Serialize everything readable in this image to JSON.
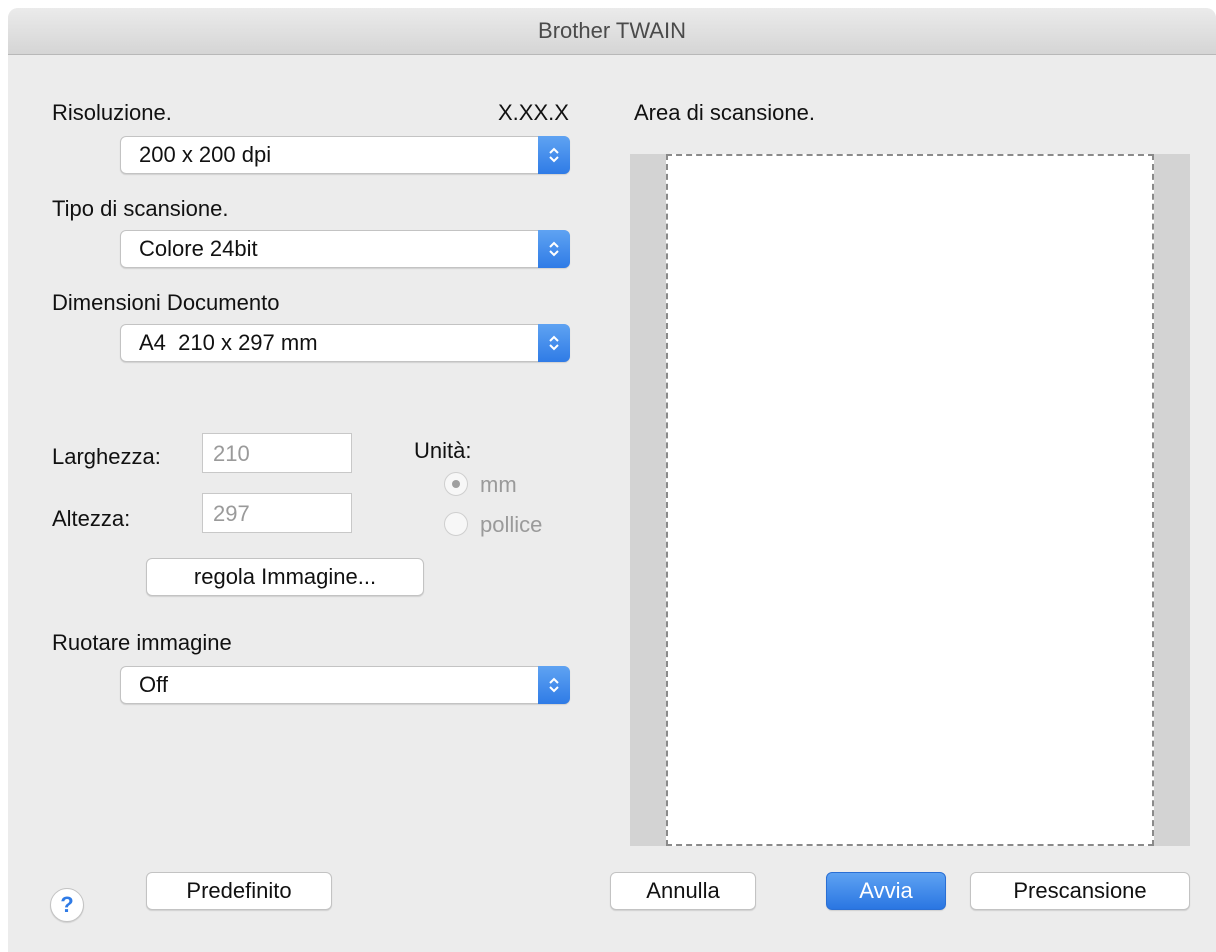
{
  "window": {
    "title": "Brother TWAIN"
  },
  "resolution": {
    "label": "Risoluzione.",
    "version": "X.XX.X",
    "value": "200 x 200 dpi"
  },
  "scan_type": {
    "label": "Tipo di scansione.",
    "value": "Colore 24bit"
  },
  "document_size": {
    "label": "Dimensioni Documento",
    "value": "A4  210 x 297 mm"
  },
  "dimensions": {
    "width_label": "Larghezza:",
    "width_value": "210",
    "height_label": "Altezza:",
    "height_value": "297",
    "unit_label": "Unità:",
    "units": [
      {
        "label": "mm",
        "selected": true
      },
      {
        "label": "pollice",
        "selected": false
      }
    ]
  },
  "adjust_button": "regola Immagine...",
  "rotate": {
    "label": "Ruotare immagine",
    "value": "Off"
  },
  "scan_area": {
    "label": "Area di scansione."
  },
  "footer": {
    "help": "?",
    "default_button": "Predefinito",
    "cancel_button": "Annulla",
    "start_button": "Avvia",
    "prescan_button": "Prescansione"
  },
  "colors": {
    "accent": "#2f7be6",
    "window_bg": "#ececec"
  }
}
